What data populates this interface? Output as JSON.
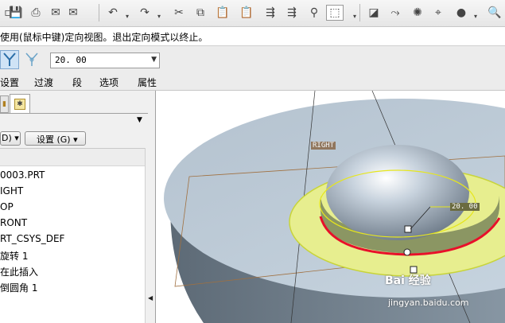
{
  "toolbar": {
    "icons": [
      "new-file-icon",
      "save-icon",
      "print-icon",
      "email-icon",
      "email-preview-icon",
      "undo-icon",
      "redo-icon",
      "cut-icon",
      "copy-icon",
      "paste-icon",
      "paste-special-icon",
      "regenerate-icon",
      "find-icon",
      "select-box-icon",
      "datum-display-icon",
      "datum-axes-icon",
      "datum-points-icon",
      "csys-icon",
      "shading-icon",
      "zoom-icon"
    ]
  },
  "message": "使用(鼠标中键)定向视图。退出定向模式以终止。",
  "dashboard": {
    "value": "20. 00"
  },
  "tabs": [
    "设置",
    "过渡",
    "段",
    "选项",
    "属性"
  ],
  "panel": {
    "drop1_label": "D) ▾",
    "drop2_label": "设置 (G) ▾",
    "tree_items": [
      "0003.PRT",
      "IGHT",
      "OP",
      "RONT",
      "RT_CSYS_DEF",
      "旋转 1",
      "在此插入",
      "倒圆角 1"
    ]
  },
  "viewport": {
    "datum_label": "RIGHT",
    "dimension_value": "20. 00",
    "watermark": "Bai 经验",
    "watermark_url": "jingyan.baidu.com"
  },
  "colors": {
    "background_model": "#c3d0dc",
    "highlight_fill": "#e7ee8f",
    "edge_red": "#e8102a"
  }
}
